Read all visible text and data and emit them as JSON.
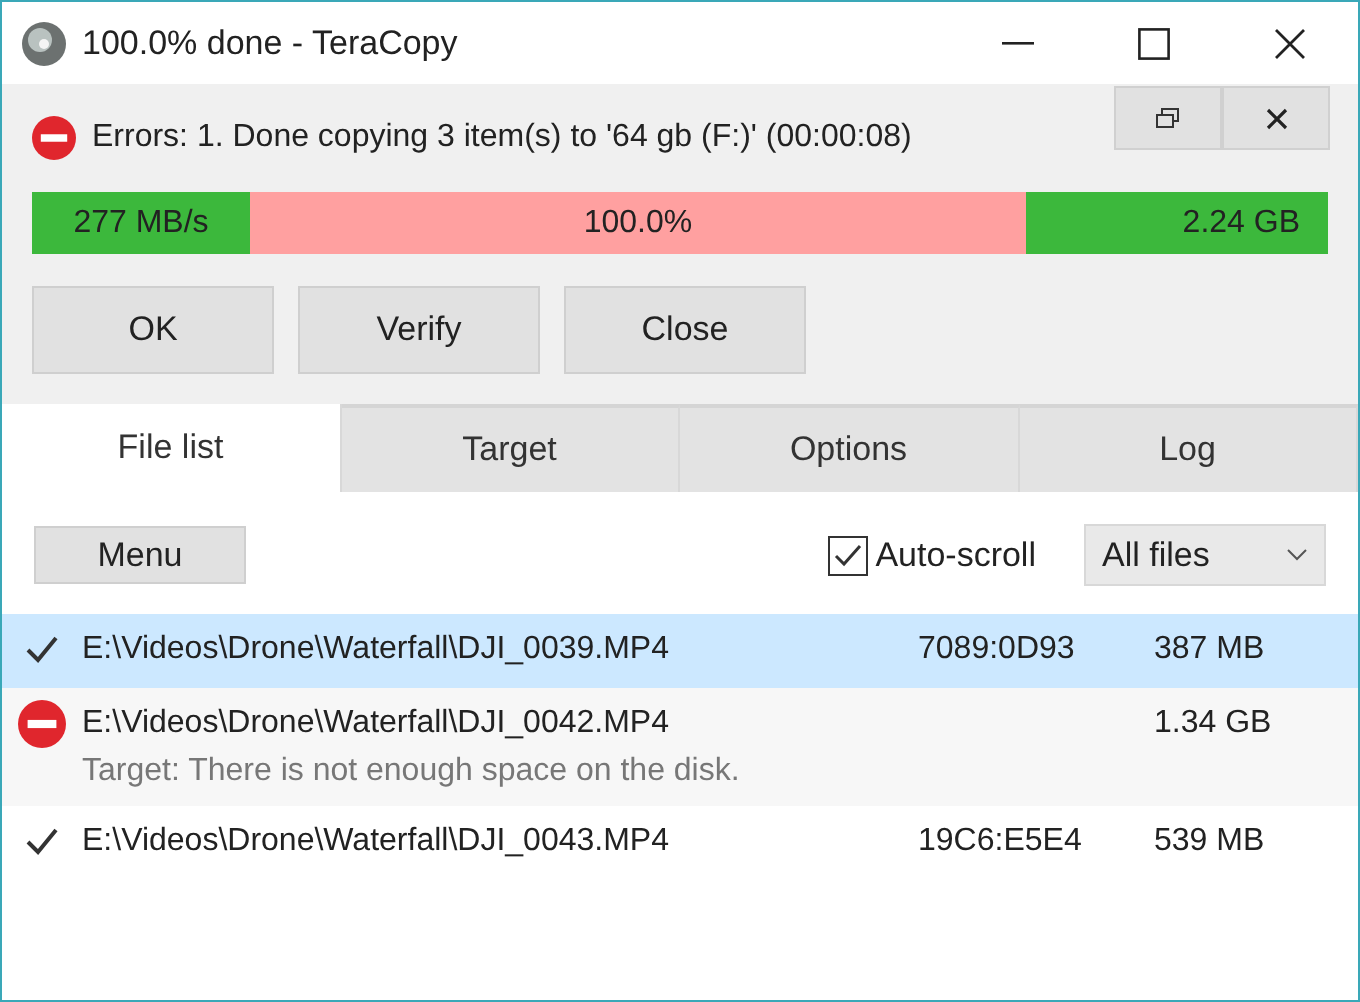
{
  "window": {
    "title": "100.0% done - TeraCopy"
  },
  "status": {
    "kind": "error",
    "message": "Errors: 1. Done copying 3 item(s) to '64 gb (F:)' (00:00:08)"
  },
  "progress": {
    "error": true,
    "speed": "277 MB/s",
    "percent": "100.0%",
    "size": "2.24 GB"
  },
  "buttons": [
    "OK",
    "Verify",
    "Close"
  ],
  "tabs": [
    {
      "label": "File list",
      "selected": true
    },
    {
      "label": "Target",
      "selected": false
    },
    {
      "label": "Options",
      "selected": false
    },
    {
      "label": "Log",
      "selected": false
    }
  ],
  "toolbar": {
    "menu": "Menu",
    "auto_scroll": {
      "label": "Auto-scroll",
      "checked": true
    },
    "filter": "All files"
  },
  "files": [
    {
      "kind": "ok",
      "selected": true,
      "path": "E:\\Videos\\Drone\\Waterfall\\DJI_0039.MP4",
      "hash": "7089:0D93",
      "size": "387 MB"
    },
    {
      "kind": "error",
      "selected": false,
      "path": "E:\\Videos\\Drone\\Waterfall\\DJI_0042.MP4",
      "size": "1.34 GB",
      "note": "Target: There is not enough space on the disk."
    },
    {
      "kind": "ok",
      "selected": false,
      "path": "E:\\Videos\\Drone\\Waterfall\\DJI_0043.MP4",
      "hash": "19C6:E5E4",
      "size": "539 MB"
    }
  ]
}
